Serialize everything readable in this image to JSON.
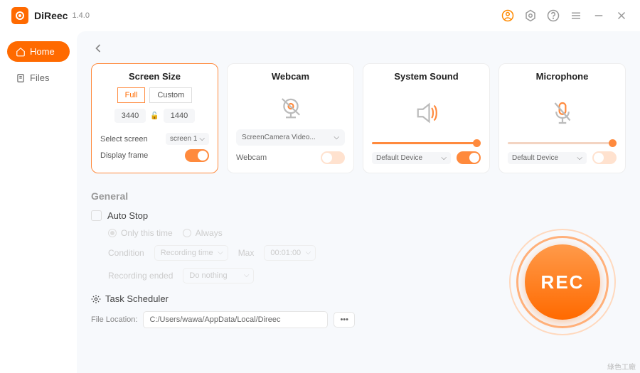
{
  "app": {
    "name": "DiReec",
    "version": "1.4.0"
  },
  "nav": {
    "home": "Home",
    "files": "Files"
  },
  "cards": {
    "screen": {
      "title": "Screen Size",
      "full": "Full",
      "custom": "Custom",
      "width": "3440",
      "height": "1440",
      "select_label": "Select screen",
      "select_value": "screen 1",
      "display_frame": "Display frame"
    },
    "webcam": {
      "title": "Webcam",
      "device": "ScreenCamera Video...",
      "label": "Webcam"
    },
    "sound": {
      "title": "System Sound",
      "device": "Default Device"
    },
    "mic": {
      "title": "Microphone",
      "device": "Default Device"
    }
  },
  "general": {
    "title": "General",
    "auto_stop": "Auto Stop",
    "only_this": "Only this time",
    "always": "Always",
    "condition": "Condition",
    "condition_val": "Recording time",
    "max": "Max",
    "max_val": "00:01:00",
    "rec_ended": "Recording ended",
    "rec_ended_val": "Do nothing",
    "task_scheduler": "Task Scheduler",
    "file_loc_label": "File Location:",
    "file_loc_val": "C:/Users/wawa/AppData/Local/Direec",
    "dots": "•••"
  },
  "rec": "REC",
  "watermark": "綠色工廠"
}
